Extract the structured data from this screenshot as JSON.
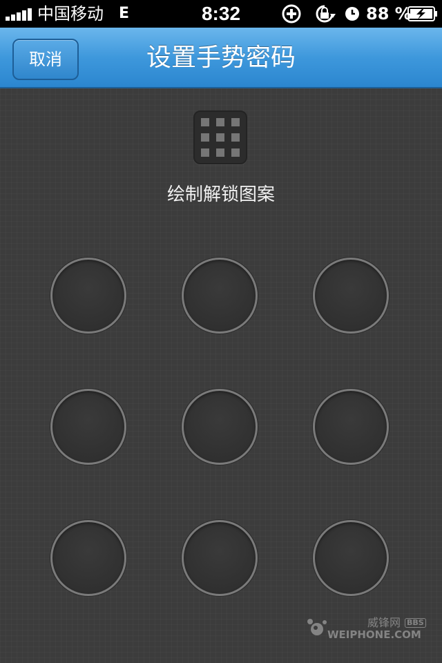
{
  "status_bar": {
    "carrier": "中国移动",
    "network": "E",
    "time": "8:32",
    "battery_percent": "88 %",
    "icons": [
      "signal-icon",
      "add-circle-icon",
      "rotation-lock-icon",
      "alarm-clock-icon",
      "battery-charging-icon"
    ]
  },
  "nav": {
    "title": "设置手势密码",
    "cancel_label": "取消"
  },
  "main": {
    "instruction": "绘制解锁图案",
    "pattern_icon": "grid-icon",
    "dots": [
      1,
      2,
      3,
      4,
      5,
      6,
      7,
      8,
      9
    ]
  },
  "watermark": {
    "cn": "威锋网",
    "bbs": "BBS",
    "en": "WEIPHONE.COM"
  },
  "colors": {
    "nav_blue": "#3e98dc",
    "background": "#3c3c3c",
    "dot_ring": "#7a7a7a"
  }
}
